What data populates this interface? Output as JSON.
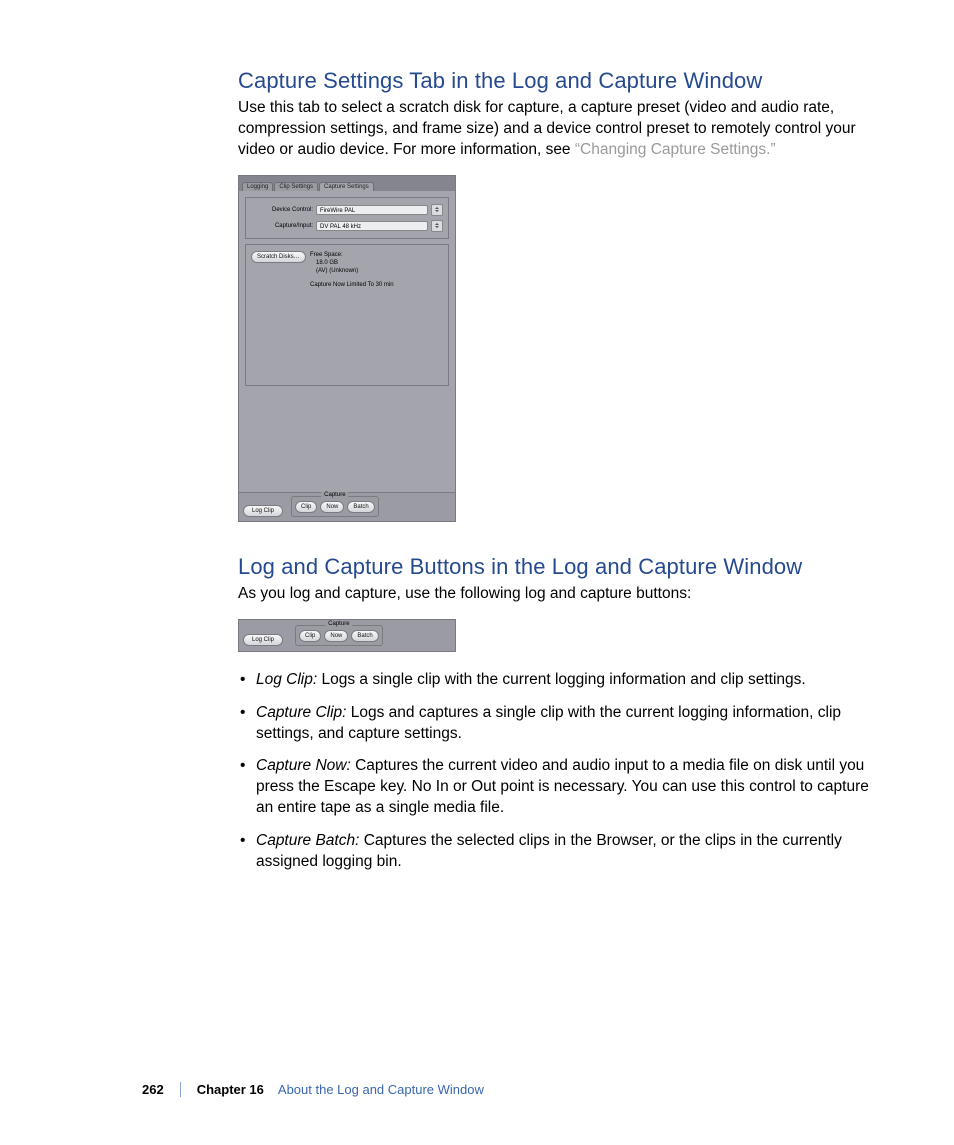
{
  "section1": {
    "heading": "Capture Settings Tab in the Log and Capture Window",
    "para_a": "Use this tab to select a scratch disk for capture, a capture preset (video and audio rate, compression settings, and frame size) and a device control preset to remotely control your video or audio device. For more information, see ",
    "link": "“Changing Capture Settings.”"
  },
  "figure1": {
    "tabs": {
      "logging": "Logging",
      "clip_settings": "Clip Settings",
      "capture_settings": "Capture Settings"
    },
    "device_control_label": "Device Control:",
    "device_control_value": "FireWire PAL",
    "capture_input_label": "Capture/Input:",
    "capture_input_value": "DV PAL 48 kHz",
    "scratch_disks_btn": "Scratch Disks…",
    "free_space_l1": "Free Space:",
    "free_space_l2": "18.0 GB",
    "free_space_l3": "(AV) (Unknown)",
    "limit_text": "Capture Now Limited To 30 min",
    "log_clip_btn": "Log Clip",
    "capture_label": "Capture",
    "clip_btn": "Clip",
    "now_btn": "Now",
    "batch_btn": "Batch"
  },
  "section2": {
    "heading": "Log and Capture Buttons in the Log and Capture Window",
    "intro": "As you log and capture, use the following log and capture buttons:"
  },
  "bullets": [
    {
      "term": "Log Clip:  ",
      "desc": "Logs a single clip with the current logging information and clip settings."
    },
    {
      "term": "Capture Clip:  ",
      "desc": "Logs and captures a single clip with the current logging information, clip settings, and capture settings."
    },
    {
      "term": "Capture Now:  ",
      "desc": "Captures the current video and audio input to a media file on disk until you press the Escape key. No In or Out point is necessary. You can use this control to capture an entire tape as a single media file."
    },
    {
      "term": "Capture Batch:  ",
      "desc": "Captures the selected clips in the Browser, or the clips in the currently assigned logging bin."
    }
  ],
  "footer": {
    "page": "262",
    "chapter_label": "Chapter 16",
    "chapter_title": "About the Log and Capture Window"
  }
}
